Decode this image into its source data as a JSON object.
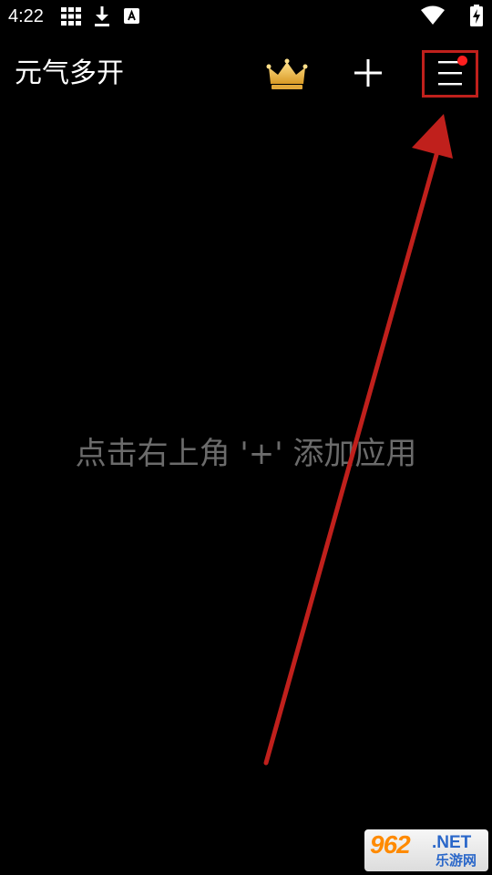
{
  "status_bar": {
    "time": "4:22",
    "left_icons": [
      "grid-icon",
      "download-icon",
      "a-badge-icon"
    ],
    "right_icons": [
      "wifi-icon",
      "battery-charging-icon"
    ]
  },
  "app_bar": {
    "title": "元气多开",
    "actions": [
      "crown-icon",
      "plus-icon",
      "menu-icon"
    ],
    "menu_has_notification": true
  },
  "main": {
    "empty_hint": "点击右上角 '+' 添加应用"
  },
  "annotation": {
    "highlight_target": "menu-button",
    "color": "#c0201c"
  },
  "watermark": {
    "number": "962",
    "domain": ".NET",
    "text": "乐游网"
  },
  "colors": {
    "background": "#000000",
    "title_text": "#ffffff",
    "hint_text": "#6b6b6b",
    "crown": "#f2c14e",
    "notification_dot": "#ff1f1f"
  }
}
